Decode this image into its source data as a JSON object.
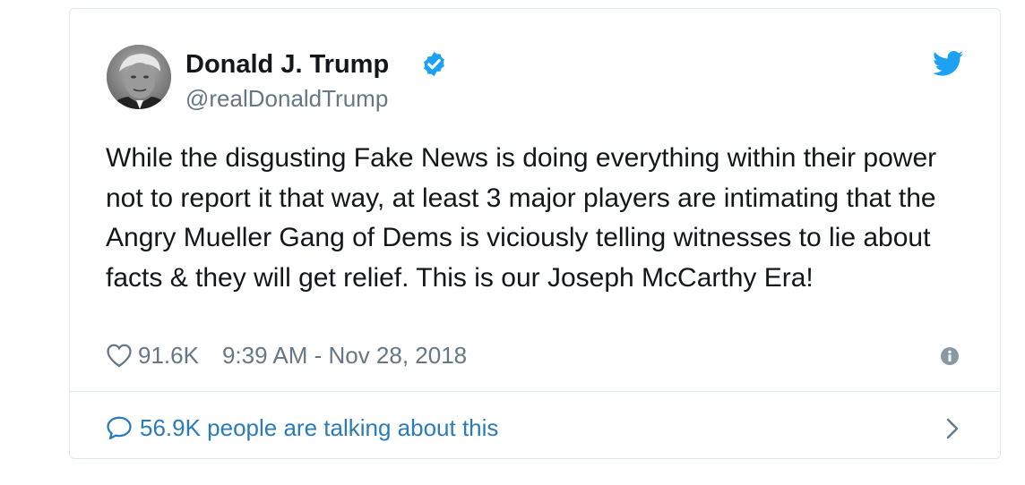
{
  "author": {
    "display_name": "Donald J. Trump",
    "handle": "@realDonaldTrump",
    "verified": true
  },
  "tweet": {
    "text": "While the disgusting Fake News is doing everything within their power not to report it that way, at least 3 major players are intimating that the Angry Mueller Gang of Dems is viciously telling witnesses to lie about facts & they will get relief. This is our Joseph McCarthy Era!",
    "likes": "91.6K",
    "timestamp": "9:39 AM - Nov 28, 2018"
  },
  "footer": {
    "talking_label": "56.9K people are talking about this"
  },
  "icons": {
    "brand": "twitter-bird-icon",
    "verified": "verified-badge-icon",
    "like": "heart-icon",
    "info": "info-icon",
    "reply": "speech-bubble-icon",
    "more": "chevron-right-icon"
  },
  "colors": {
    "twitter_blue": "#1da1f2",
    "link_blue": "#2b7bb9",
    "text": "#14171a",
    "muted": "#657786",
    "border": "#e1e8ed"
  }
}
